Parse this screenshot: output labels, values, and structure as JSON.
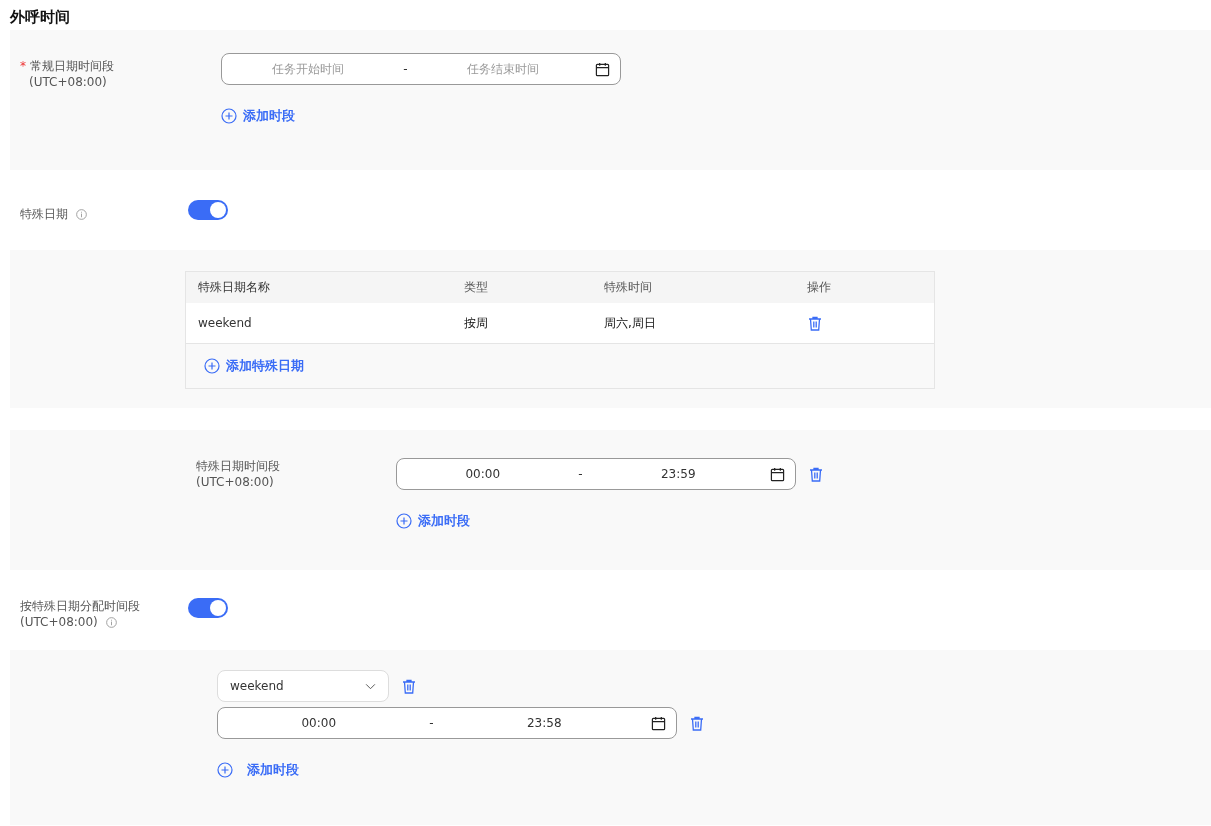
{
  "page_title": "外呼时间",
  "regular_period": {
    "required_mark": "*",
    "label": "常规日期时间段",
    "timezone": "(UTC+08:00)",
    "range": {
      "start_placeholder": "任务开始时间",
      "separator": "-",
      "end_placeholder": "任务结束时间"
    },
    "add_button": "添加时段"
  },
  "special_dates": {
    "label": "特殊日期",
    "on": true,
    "table": {
      "columns": [
        "特殊日期名称",
        "类型",
        "特殊时间",
        "操作"
      ],
      "rows": [
        {
          "name": "weekend",
          "type": "按周",
          "time": "周六,周日"
        }
      ],
      "add_button": "添加特殊日期"
    }
  },
  "special_period": {
    "label": "特殊日期时间段",
    "timezone": "(UTC+08:00)",
    "range": {
      "start": "00:00",
      "separator": "-",
      "end": "23:59"
    },
    "add_button": "添加时段"
  },
  "assign_by_special": {
    "label": "按特殊日期分配时间段",
    "timezone": "(UTC+08:00)",
    "on": true,
    "select_value": "weekend",
    "range": {
      "start": "00:00",
      "separator": "-",
      "end": "23:58"
    },
    "add_button": "添加时段"
  }
}
